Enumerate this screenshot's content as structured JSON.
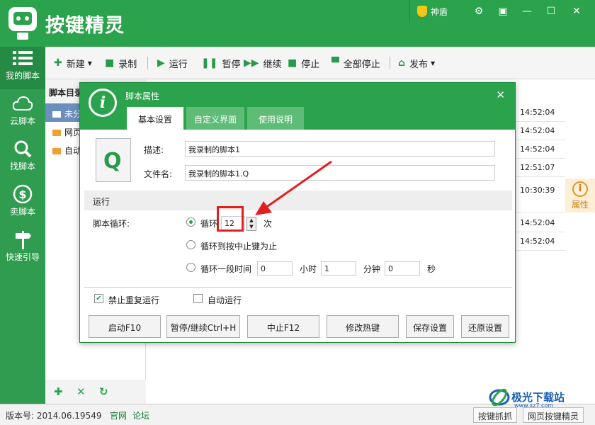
{
  "app": {
    "title": "按键精灵",
    "shield_label": "神盾"
  },
  "sidebar": {
    "items": [
      {
        "label": "我的脚本",
        "icon": "list-icon"
      },
      {
        "label": "云脚本",
        "icon": "cloud-icon"
      },
      {
        "label": "找脚本",
        "icon": "search-icon"
      },
      {
        "label": "卖脚本",
        "icon": "dollar-icon"
      },
      {
        "label": "快速引导",
        "icon": "signpost-icon"
      }
    ]
  },
  "toolbar": {
    "new": "新建",
    "record": "录制",
    "run": "运行",
    "pause": "暂停",
    "continue": "继续",
    "stop": "停止",
    "stop_all": "全部停止",
    "publish": "发布"
  },
  "left_panel": {
    "header": "脚本目录",
    "items": [
      "未分",
      "网页",
      "自动"
    ]
  },
  "times": [
    "14:52:04",
    "14:52:04",
    "14:52:04",
    "12:51:07",
    "10:30:39",
    "14:52:04",
    "14:52:04"
  ],
  "property_label": "属性",
  "dialog": {
    "title": "脚本属性",
    "tabs": [
      "基本设置",
      "自定义界面",
      "使用说明"
    ],
    "desc_label": "描述:",
    "desc_value": "我录制的脚本1",
    "filename_label": "文件名:",
    "filename_value": "我录制的脚本1.Q",
    "section_run": "运行",
    "loop_label": "脚本循环:",
    "loop_times_prefix": "循环",
    "loop_times_value": "12",
    "loop_times_suffix": "次",
    "loop_until_stop": "循环到按中止键为止",
    "loop_period": "循环一段时间",
    "hours_value": "0",
    "hours_unit": "小时",
    "minutes_value": "1",
    "minutes_unit": "分钟",
    "seconds_value": "0",
    "seconds_unit": "秒",
    "no_repeat": "禁止重复运行",
    "auto_run": "自动运行",
    "buttons": {
      "start": "启动F10",
      "pause": "暂停/继续Ctrl+H",
      "stop": "中止F12",
      "hotkey": "修改热键",
      "save": "保存设置",
      "restore": "还原设置"
    }
  },
  "status": {
    "version": "版本号: 2014.06.19549",
    "link_official": "官网",
    "link_forum": "论坛",
    "btn_capture": "按键抓抓",
    "btn_web": "网页按键精灵"
  },
  "watermark": {
    "text": "极光下载站",
    "url": "www.xz7.com"
  },
  "colors": {
    "brand_green": "#2aa34c",
    "arrow_red": "#e02020"
  }
}
